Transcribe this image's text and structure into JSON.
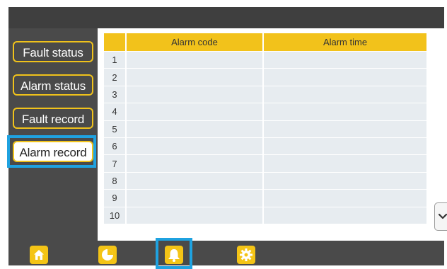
{
  "sidebar": {
    "items": [
      {
        "label": "Fault status"
      },
      {
        "label": "Alarm status"
      },
      {
        "label": "Fault record"
      },
      {
        "label": "Alarm record",
        "active": true
      }
    ]
  },
  "table": {
    "columns": [
      "",
      "Alarm code",
      "Alarm time"
    ],
    "rows": [
      "1",
      "2",
      "3",
      "4",
      "5",
      "6",
      "7",
      "8",
      "9",
      "10"
    ]
  },
  "nav": {
    "items": [
      {
        "icon": "home-icon"
      },
      {
        "icon": "pie-chart-icon"
      },
      {
        "icon": "bell-icon",
        "active": true
      },
      {
        "icon": "gear-icon"
      }
    ]
  },
  "colors": {
    "accent": "#f2c21b",
    "highlight": "#1fa2e0",
    "background": "#4a4a4a",
    "cell": "#e7ecf0"
  }
}
